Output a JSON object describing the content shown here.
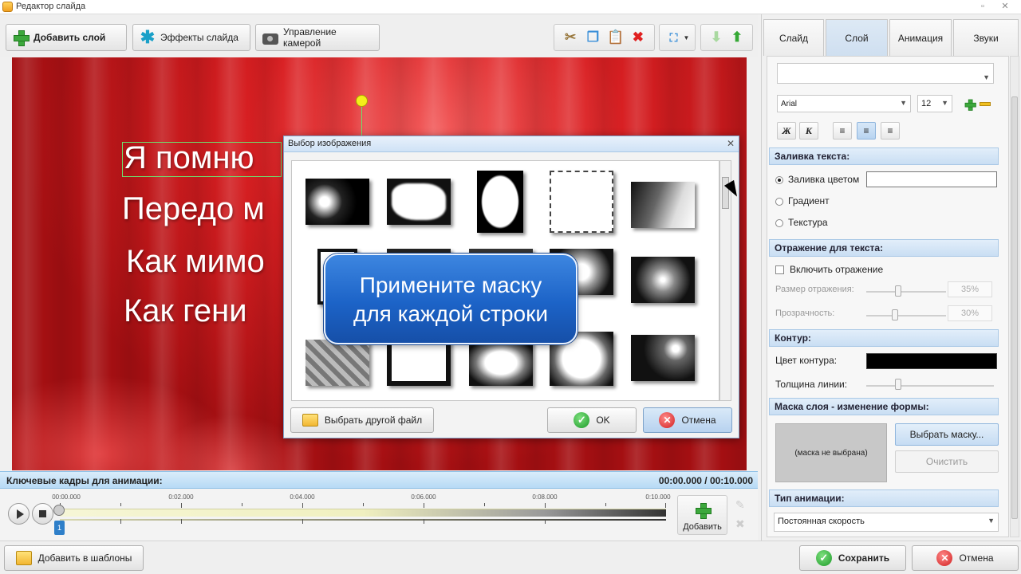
{
  "window": {
    "title": "Редактор слайда"
  },
  "toolbar": {
    "add_layer": "Добавить слой",
    "slide_effects": "Эффекты слайда",
    "camera_control": "Управление камерой"
  },
  "preview": {
    "lines": [
      "Я помню",
      "Передо м",
      "Как мимо",
      "Как гени"
    ]
  },
  "dialog": {
    "title": "Выбор изображения",
    "choose_file": "Выбрать другой файл",
    "ok": "OK",
    "cancel": "Отмена"
  },
  "callout": {
    "line1": "Примените маску",
    "line2": "для каждой строки"
  },
  "timeline": {
    "header": "Ключевые кадры для анимации:",
    "time": "00:00.000 / 00:10.000",
    "ticks": [
      "00:00.000",
      "0:02.000",
      "0:04.000",
      "0:06.000",
      "0:08.000",
      "0:10.000"
    ],
    "keyframe_number": "1",
    "add_label": "Добавить"
  },
  "bottom": {
    "add_templates": "Добавить в шаблоны",
    "save": "Сохранить",
    "cancel": "Отмена"
  },
  "panel": {
    "tabs": [
      "Слайд",
      "Слой",
      "Анимация",
      "Звуки"
    ],
    "active_tab": "Слой",
    "font": "Arial",
    "font_size": "12",
    "fmt": {
      "bold": "Ж",
      "italic": "К"
    },
    "fill_header": "Заливка текста:",
    "fill_color": "Заливка цветом",
    "gradient": "Градиент",
    "texture": "Текстура",
    "reflection_header": "Отражение для текста:",
    "enable_reflection": "Включить отражение",
    "reflection_size": "Размер отражения:",
    "reflection_size_val": "35%",
    "transparency": "Прозрачность:",
    "transparency_val": "30%",
    "contour_header": "Контур:",
    "contour_color": "Цвет контура:",
    "line_width": "Толщина линии:",
    "mask_header": "Маска слоя - изменение формы:",
    "mask_none": "(маска не выбрана)",
    "choose_mask": "Выбрать маску...",
    "clear": "Очистить",
    "anim_type_header": "Тип анимации:",
    "anim_type": "Постоянная скорость"
  },
  "colors": {
    "accent_blue": "#1c63c7",
    "preview_red": "#d81f22",
    "ok_green": "#1d9a2a",
    "cancel_red": "#d11f1f"
  }
}
